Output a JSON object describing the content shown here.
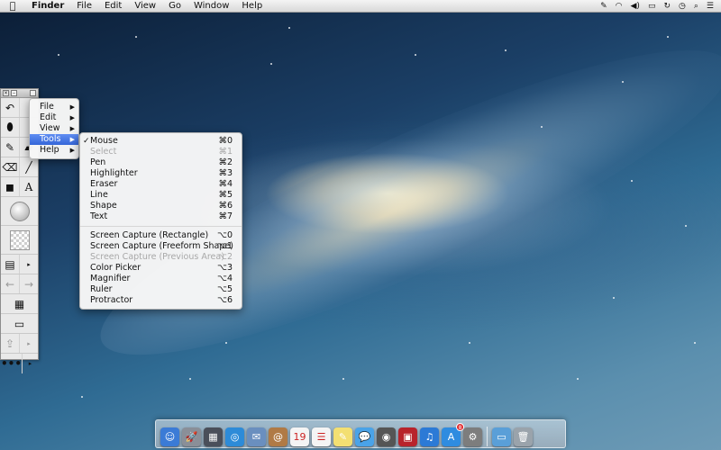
{
  "menubar": {
    "apple": "",
    "app_name": "Finder",
    "items": [
      "File",
      "Edit",
      "View",
      "Go",
      "Window",
      "Help"
    ],
    "status_icons": [
      "pencil-icon",
      "wifi-icon",
      "volume-icon",
      "battery-icon",
      "sync-icon",
      "clock-icon",
      "search-icon",
      "list-icon"
    ]
  },
  "palette_menu": {
    "items": [
      {
        "label": "File",
        "submenu": true
      },
      {
        "label": "Edit",
        "submenu": true
      },
      {
        "label": "View",
        "submenu": true
      },
      {
        "label": "Tools",
        "submenu": true,
        "selected": true
      },
      {
        "label": "Help",
        "submenu": true
      }
    ]
  },
  "tools_menu": {
    "group1": [
      {
        "label": "Mouse",
        "shortcut": "⌘0",
        "checked": true,
        "disabled": false
      },
      {
        "label": "Select",
        "shortcut": "⌘1",
        "checked": false,
        "disabled": true
      },
      {
        "label": "Pen",
        "shortcut": "⌘2",
        "checked": false,
        "disabled": false
      },
      {
        "label": "Highlighter",
        "shortcut": "⌘3",
        "checked": false,
        "disabled": false
      },
      {
        "label": "Eraser",
        "shortcut": "⌘4",
        "checked": false,
        "disabled": false
      },
      {
        "label": "Line",
        "shortcut": "⌘5",
        "checked": false,
        "disabled": false
      },
      {
        "label": "Shape",
        "shortcut": "⌘6",
        "checked": false,
        "disabled": false
      },
      {
        "label": "Text",
        "shortcut": "⌘7",
        "checked": false,
        "disabled": false
      }
    ],
    "group2": [
      {
        "label": "Screen Capture (Rectangle)",
        "shortcut": "⌥0",
        "disabled": false
      },
      {
        "label": "Screen Capture (Freeform Shape)",
        "shortcut": "⌥1",
        "disabled": false
      },
      {
        "label": "Screen Capture (Previous Area)",
        "shortcut": "⌥2",
        "disabled": true
      },
      {
        "label": "Color Picker",
        "shortcut": "⌥3",
        "disabled": false
      },
      {
        "label": "Magnifier",
        "shortcut": "⌥4",
        "disabled": false
      },
      {
        "label": "Ruler",
        "shortcut": "⌥5",
        "disabled": false
      },
      {
        "label": "Protractor",
        "shortcut": "⌥6",
        "disabled": false
      }
    ]
  },
  "dock": {
    "icons": [
      {
        "name": "finder-icon",
        "color": "#3b7bd6",
        "glyph": "☺"
      },
      {
        "name": "launchpad-icon",
        "color": "#8a8f98",
        "glyph": "🚀"
      },
      {
        "name": "mission-control-icon",
        "color": "#4a4f5a",
        "glyph": "▦"
      },
      {
        "name": "safari-icon",
        "color": "#2d8bd8",
        "glyph": "◎"
      },
      {
        "name": "mail-icon",
        "color": "#6a8fbf",
        "glyph": "✉"
      },
      {
        "name": "contacts-icon",
        "color": "#b07a45",
        "glyph": "@"
      },
      {
        "name": "calendar-icon",
        "color": "#f4f4f4",
        "glyph": "19"
      },
      {
        "name": "reminders-icon",
        "color": "#f4f4f4",
        "glyph": "☰"
      },
      {
        "name": "notes-icon",
        "color": "#f3df72",
        "glyph": "✎"
      },
      {
        "name": "messages-icon",
        "color": "#4aa3e8",
        "glyph": "💬"
      },
      {
        "name": "facetime-icon",
        "color": "#555",
        "glyph": "◉"
      },
      {
        "name": "photo-booth-icon",
        "color": "#b8232b",
        "glyph": "▣"
      },
      {
        "name": "itunes-icon",
        "color": "#2c7ad6",
        "glyph": "♫"
      },
      {
        "name": "app-store-icon",
        "color": "#2f8ce0",
        "glyph": "A",
        "badge": "8"
      },
      {
        "name": "system-preferences-icon",
        "color": "#7d7d7d",
        "glyph": "⚙"
      }
    ],
    "right_icons": [
      {
        "name": "downloads-folder-icon",
        "color": "#5a9fd8",
        "glyph": "▭"
      },
      {
        "name": "trash-icon",
        "color": "#9aa3ab",
        "glyph": "🗑"
      }
    ]
  }
}
